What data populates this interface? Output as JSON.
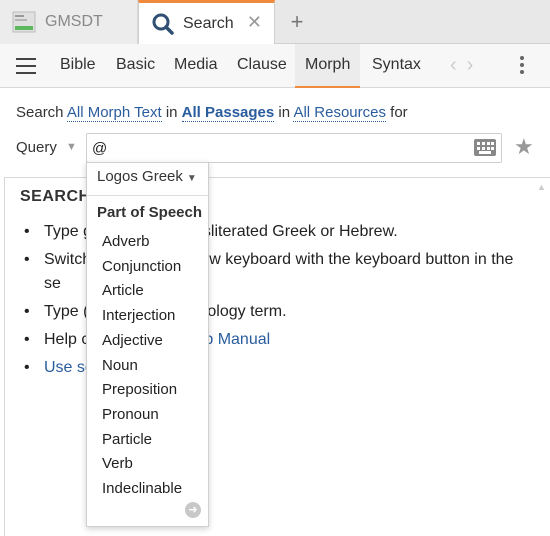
{
  "tabs": [
    {
      "label": "GMSDT",
      "active": false
    },
    {
      "label": "Search",
      "active": true
    }
  ],
  "toolbar": {
    "nav_tabs": [
      "Bible",
      "Basic",
      "Media",
      "Clause",
      "Morph",
      "Syntax"
    ],
    "active_tab": "Morph"
  },
  "search": {
    "prefix": "Search",
    "scope": "All Morph Text",
    "in1": "in",
    "passages": "All Passages",
    "in2": "in",
    "resources": "All Resources",
    "suffix": "for",
    "query_label": "Query",
    "query_value": "@"
  },
  "help": {
    "heading": "SEARCH",
    "items": [
      {
        "text": "Type g",
        "hidden_tail": "nsliterated Greek or Hebrew."
      },
      {
        "text": "Switch",
        "hidden_tail": "brew keyboard with the keyboard button in the se"
      },
      {
        "text": "Type (",
        "hidden_tail": "hology term."
      },
      {
        "text": "Help c",
        "link": "p Manual"
      },
      {
        "link": "Use se"
      }
    ]
  },
  "dropdown": {
    "language": "Logos Greek",
    "heading": "Part of Speech",
    "items": [
      "Adverb",
      "Conjunction",
      "Article",
      "Interjection",
      "Adjective",
      "Noun",
      "Preposition",
      "Pronoun",
      "Particle",
      "Verb",
      "Indeclinable"
    ]
  },
  "colors": {
    "accent": "#f08a3c",
    "link": "#2a5d9e"
  },
  "icons": {
    "search_tab": "search-icon",
    "keyboard": "keyboard-icon",
    "star": "star-icon",
    "more": "more-arrow-icon"
  }
}
